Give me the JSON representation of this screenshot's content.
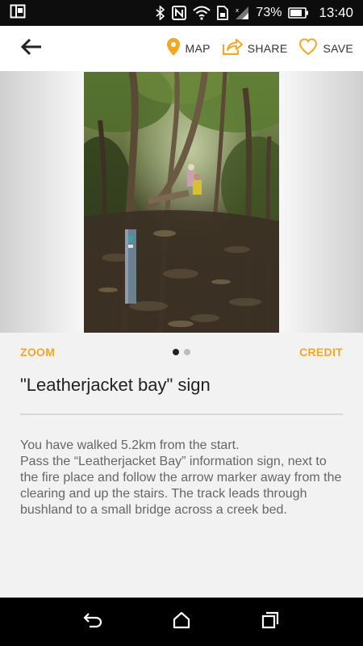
{
  "status_bar": {
    "battery_percent": "73%",
    "time": "13:40",
    "icons": [
      "screen-mirror-icon",
      "bluetooth-icon",
      "nfc-icon",
      "wifi-icon",
      "sim-icon",
      "signal-icon",
      "battery-icon"
    ]
  },
  "app_bar": {
    "back_icon": "arrow-left-icon",
    "map_label": "MAP",
    "share_label": "SHARE",
    "save_label": "SAVE",
    "accent_color": "#f5a623"
  },
  "gallery": {
    "zoom_label": "ZOOM",
    "credit_label": "CREDIT",
    "page_count": 2,
    "active_page": 1
  },
  "content": {
    "title": "\"Leatherjacket bay\" sign",
    "description": "You have walked 5.2km from the start.\nPass the “Leatherjacket Bay” information sign, next to the fire place and follow the arrow marker away from the clearing and up the stairs. The track leads through bushland to a small bridge across a creek bed."
  },
  "nav_bar": {
    "icons": [
      "back-nav-icon",
      "home-nav-icon",
      "recents-nav-icon"
    ]
  }
}
